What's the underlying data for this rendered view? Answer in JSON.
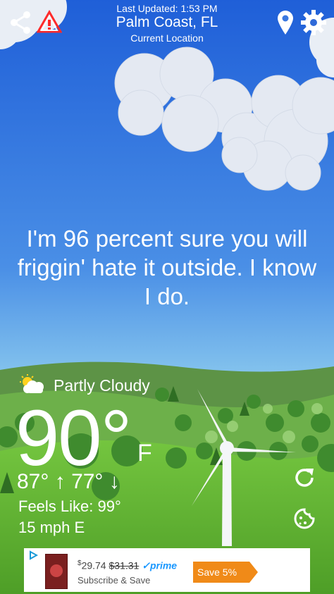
{
  "header": {
    "last_updated": "Last Updated: 1:53 PM",
    "location": "Palm Coast, FL",
    "location_sub": "Current Location"
  },
  "quote": "I'm 96 percent sure you will friggin' hate it outside. I know I do.",
  "weather": {
    "condition": "Partly Cloudy",
    "temperature": "90°",
    "unit": "F",
    "high": "87°",
    "low": "77°",
    "feels_like": "Feels Like: 99°",
    "wind": "15 mph E"
  },
  "ad": {
    "price": "29.74",
    "old_price": "$31.31",
    "prime": "prime",
    "subscribe": "Subscribe & Save",
    "save": "Save 5%"
  },
  "icons": [
    "share-icon",
    "alert-icon",
    "location-pin-icon",
    "gear-icon",
    "partly-cloudy-icon",
    "refresh-icon",
    "cookie-icon",
    "ad-choices-icon"
  ],
  "colors": {
    "sky_top": "#1f5fd8",
    "sky_bottom": "#9ad7f0",
    "grass": "#6cbf3a",
    "ad_save": "#f08a18",
    "prime": "#1a98ff"
  }
}
